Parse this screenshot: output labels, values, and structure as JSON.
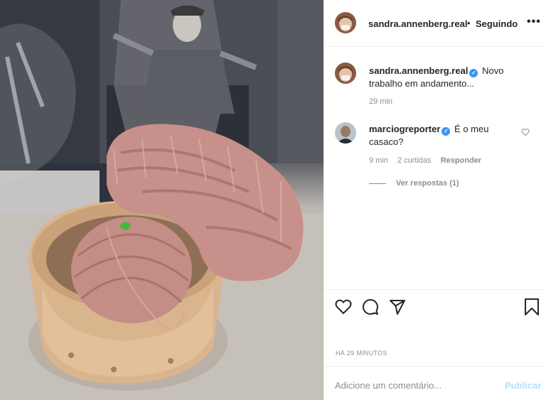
{
  "post": {
    "username": "sandra.annenberg.real",
    "separator": "•",
    "follow_label": "Seguindo",
    "more_icon": "more-options-icon",
    "more_label": "•••"
  },
  "caption": {
    "username": "sandra.annenberg.real",
    "text": "Novo trabalho em andamento...",
    "time": "29 min",
    "verified_glyph": "✓"
  },
  "comment": {
    "username": "marciogreporter",
    "text": "É o meu casaco?",
    "time": "9 min",
    "likes": "2 curtidas",
    "reply_label": "Responder",
    "view_replies": "Ver respostas (1)",
    "verified_glyph": "✓"
  },
  "actions": {
    "like_icon": "heart-icon",
    "comment_icon": "comment-icon",
    "share_icon": "share-icon",
    "save_icon": "bookmark-icon"
  },
  "footer": {
    "posted_time": "HÁ 29 MINUTOS",
    "comment_placeholder": "Adicione um comentário...",
    "publish_label": "Publicar"
  },
  "colors": {
    "verified": "#3897f0",
    "muted": "#8e8e8e",
    "publish_disabled": "#b2dffc",
    "yarn": "#c98f88"
  }
}
